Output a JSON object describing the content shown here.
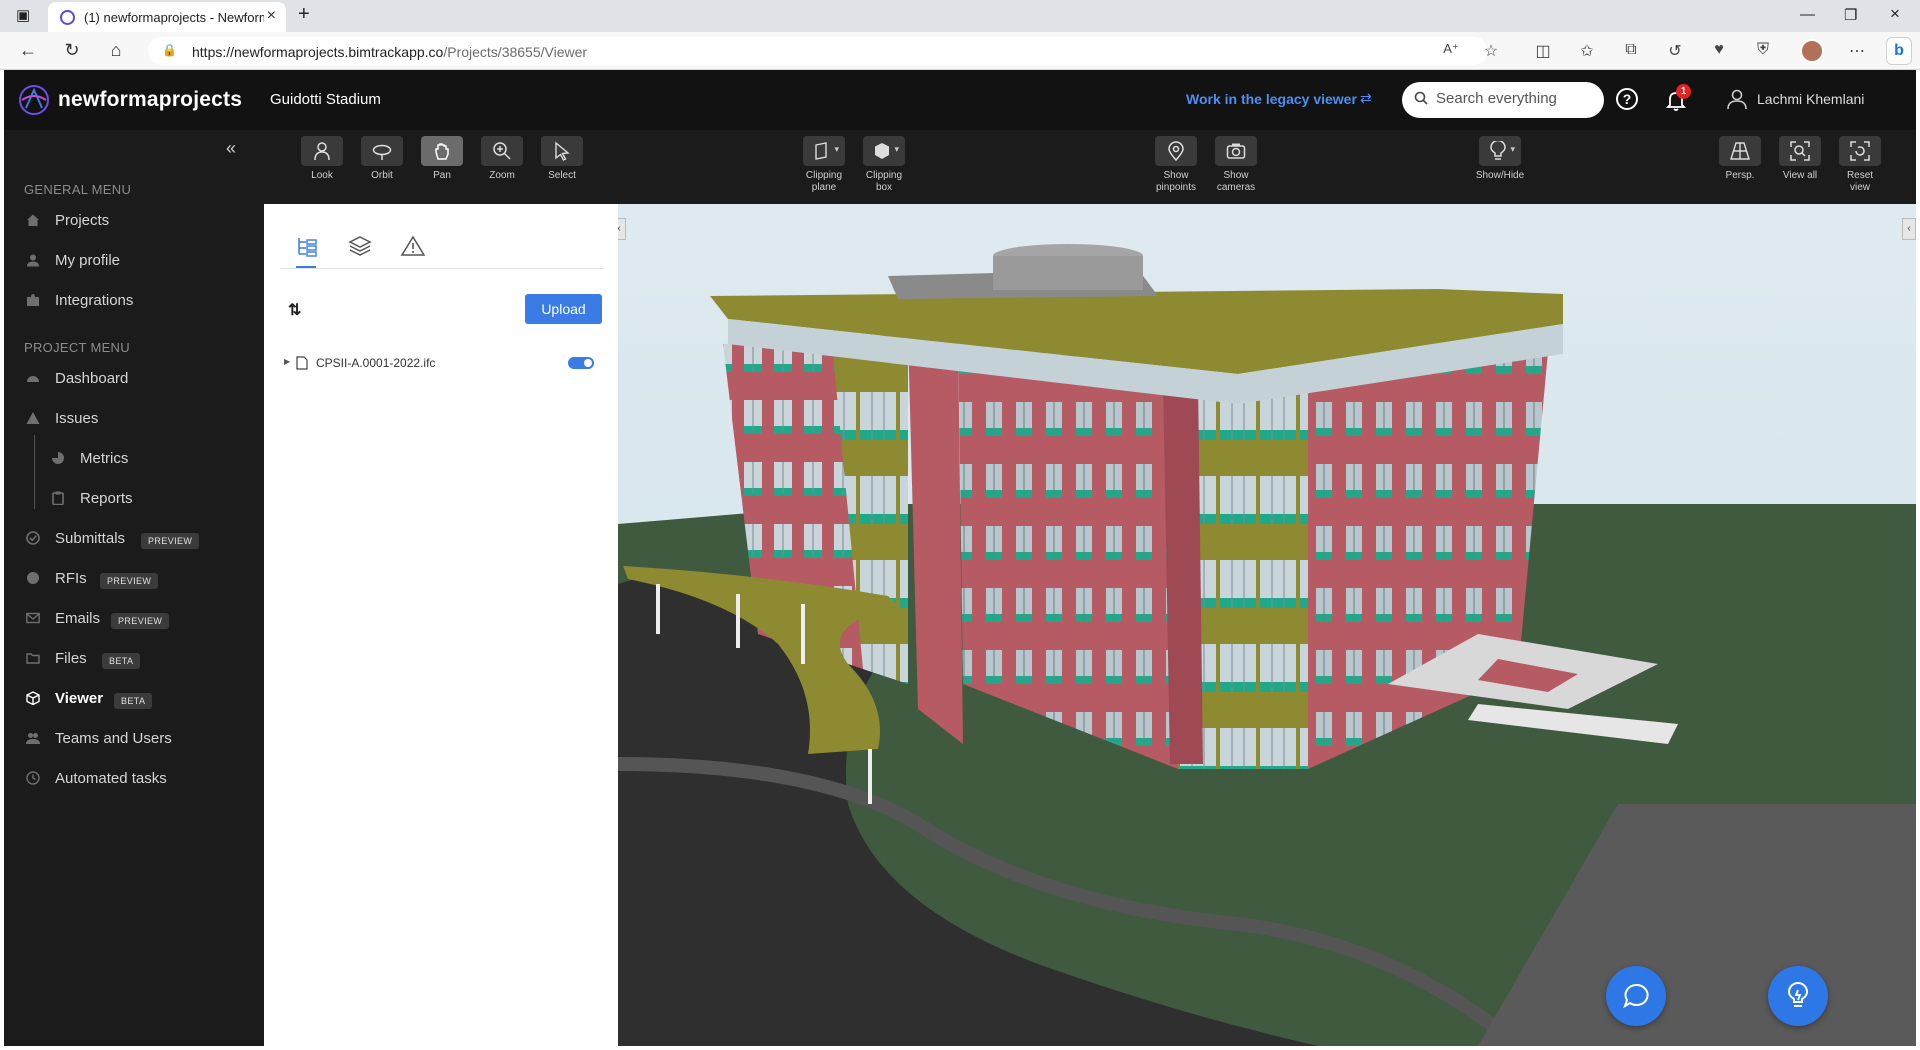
{
  "browser": {
    "tab_title": "(1) newformaprojects - Newform",
    "url_host": "https://newformaprojects.bimtrackapp.co",
    "url_path": "/Projects/38655/Viewer"
  },
  "header": {
    "brand": "newformaprojects",
    "project": "Guidotti Stadium",
    "legacy_link": "Work in the legacy viewer",
    "search_placeholder": "Search everything",
    "notification_count": "1",
    "user_name": "Lachmi Khemlani"
  },
  "sidebar": {
    "general_heading": "GENERAL MENU",
    "project_heading": "PROJECT MENU",
    "general_items": [
      {
        "label": "Projects",
        "icon": "house-icon"
      },
      {
        "label": "My profile",
        "icon": "user-icon"
      },
      {
        "label": "Integrations",
        "icon": "puzzle-icon"
      }
    ],
    "project_items": [
      {
        "label": "Dashboard",
        "icon": "gauge-icon"
      },
      {
        "label": "Issues",
        "icon": "warning-icon"
      },
      {
        "label": "Metrics",
        "icon": "pie-chart-icon"
      },
      {
        "label": "Reports",
        "icon": "clipboard-icon"
      },
      {
        "label": "Submittals",
        "icon": "check-circle-icon",
        "badge": "PREVIEW"
      },
      {
        "label": "RFIs",
        "icon": "question-icon",
        "badge": "PREVIEW"
      },
      {
        "label": "Emails",
        "icon": "mail-icon",
        "badge": "PREVIEW"
      },
      {
        "label": "Files",
        "icon": "folder-icon",
        "badge": "BETA"
      },
      {
        "label": "Viewer",
        "icon": "cube-icon",
        "badge": "BETA"
      },
      {
        "label": "Teams and Users",
        "icon": "team-icon"
      },
      {
        "label": "Automated tasks",
        "icon": "clock-icon"
      }
    ]
  },
  "toolbar": {
    "look": "Look",
    "orbit": "Orbit",
    "pan": "Pan",
    "zoom": "Zoom",
    "select": "Select",
    "clipping_plane_1": "Clipping",
    "clipping_plane_2": "plane",
    "clipping_box_1": "Clipping",
    "clipping_box_2": "box",
    "show_pinpoints_1": "Show",
    "show_pinpoints_2": "pinpoints",
    "show_cameras_1": "Show",
    "show_cameras_2": "cameras",
    "show_hide": "Show/Hide",
    "persp": "Persp.",
    "view_all": "View all",
    "reset_view_1": "Reset",
    "reset_view_2": "view"
  },
  "panel": {
    "upload": "Upload",
    "file_name": "CPSII-A.0001-2022.ifc",
    "file_visible": true
  },
  "colors": {
    "accent": "#3a7be6",
    "header_bg": "#121212",
    "sidebar_bg": "#1b1b1b",
    "facade": "#b65a64",
    "panel_olive": "#8d8a32",
    "glass_teal": "#1fa88a"
  }
}
